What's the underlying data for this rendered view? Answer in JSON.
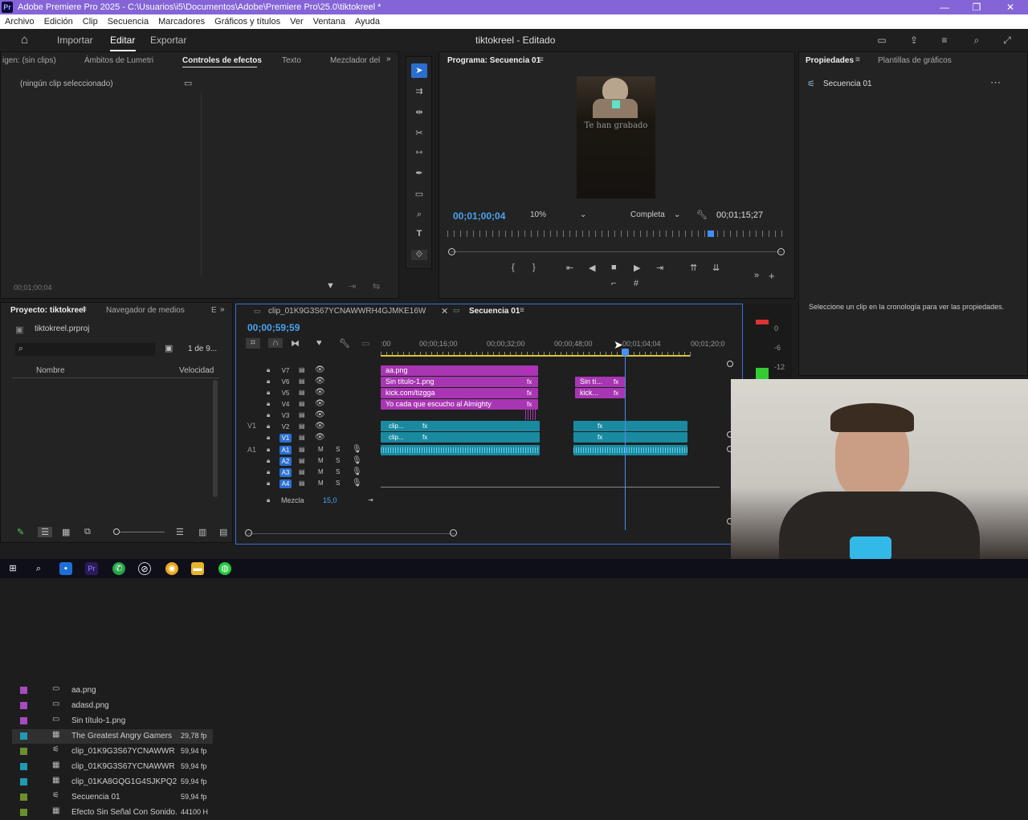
{
  "window": {
    "title": "Adobe Premiere Pro 2025 - C:\\Usuarios\\i5\\Documentos\\Adobe\\Premiere Pro\\25.0\\tiktokreel *",
    "app_icon": "Pr"
  },
  "menu": [
    "Archivo",
    "Edición",
    "Clip",
    "Secuencia",
    "Marcadores",
    "Gráficos y títulos",
    "Ver",
    "Ventana",
    "Ayuda"
  ],
  "header": {
    "tabs": [
      "Importar",
      "Editar",
      "Exportar"
    ],
    "active_tab": "Editar",
    "doc_title": "tiktokreel - Editado"
  },
  "effects_panel": {
    "tabs": [
      "igen: (sin clips)",
      "Ámbitos de Lumetri",
      "Controles de efectos",
      "Texto",
      "Mezclador del"
    ],
    "active_tab": "Controles de efectos",
    "no_clip": "(ningún clip seleccionado)",
    "timecode": "00;01;00;04"
  },
  "program_monitor": {
    "title": "Programa: Secuencia 01",
    "timecode": "00;01;00;04",
    "zoom": "10%",
    "quality": "Completa",
    "duration": "00;01;15;27",
    "video_text": "Te han grabado"
  },
  "properties_panel": {
    "tabs": [
      "Propiedades",
      "Plantillas de gráficos"
    ],
    "item": "Secuencia 01",
    "hint": "Seleccione un clip en la cronología para ver las propiedades."
  },
  "project_panel": {
    "tabs": [
      "Proyecto: tiktokreel",
      "Navegador de medios",
      "E"
    ],
    "file": "tiktokreel.prproj",
    "pager": "1 de 9...",
    "columns": [
      "Nombre",
      "Velocidad"
    ],
    "items": [
      {
        "name": "aa.png",
        "rate": "",
        "color": "#a64bc0"
      },
      {
        "name": "adasd.png",
        "rate": "",
        "color": "#a64bc0"
      },
      {
        "name": "Sin título-1.png",
        "rate": "",
        "color": "#a64bc0"
      },
      {
        "name": "The Greatest Angry Gamers",
        "rate": "29,78 fp",
        "color": "#1f9ab0"
      },
      {
        "name": "clip_01K9G3S67YCNAWWR",
        "rate": "59,94 fp",
        "color": "#6b8f2c"
      },
      {
        "name": "clip_01K9G3S67YCNAWWR",
        "rate": "59,94 fp",
        "color": "#1f9ab0"
      },
      {
        "name": "clip_01KA8GQG1G4SJKPQ2",
        "rate": "59,94 fp",
        "color": "#1f9ab0"
      },
      {
        "name": "Secuencia 01",
        "rate": "59,94 fp",
        "color": "#6b8f2c"
      },
      {
        "name": "Efecto Sin Señal Con Sonido.",
        "rate": "44100 H",
        "color": "#6b8f2c"
      }
    ]
  },
  "timeline": {
    "tabs": [
      "clip_01K9G3S67YCNAWWRH4GJMKE16W",
      "Secuencia 01"
    ],
    "active_tab": "Secuencia 01",
    "timecode": "00;00;59;59",
    "ruler": [
      ":00",
      "00;00;16;00",
      "00;00;32;00",
      "00;00;48;00",
      "00;01;04;04",
      "00;01;20;0"
    ],
    "video_tracks": [
      "V7",
      "V6",
      "V5",
      "V4",
      "V3",
      "V2",
      "V1"
    ],
    "audio_tracks": [
      "A1",
      "A2",
      "A3",
      "A4"
    ],
    "clips_v7": "aa.png",
    "clips_v6": "Sin título-1.png",
    "clips_v5": "kick.com/tizgga",
    "clips_v4": "Yo cada que escucho al Almighty",
    "clip_sin": "Sin tí...",
    "clip_kick": "kick...",
    "clip_short": "clip...",
    "fx": "fx",
    "mix_label": "Mezcla",
    "mix_value": "15,0",
    "meter_labels": [
      "0",
      "-6",
      "-12"
    ]
  }
}
